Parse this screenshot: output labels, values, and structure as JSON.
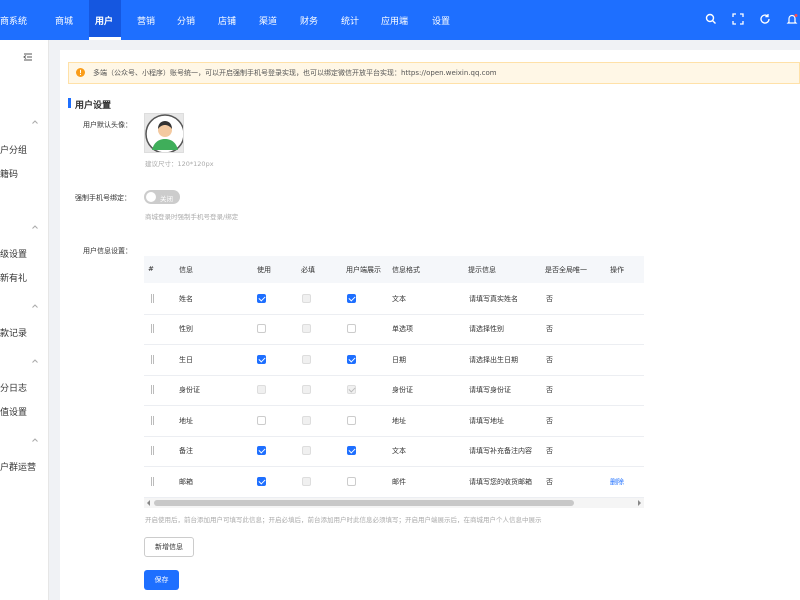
{
  "header": {
    "brand": "商系统",
    "nav": [
      "商城",
      "用户",
      "营销",
      "分销",
      "店铺",
      "渠道",
      "财务",
      "统计",
      "应用端",
      "设置"
    ],
    "active_index": 1
  },
  "sidebar": {
    "items": [
      "户分组",
      "籍码",
      "级设置",
      "新有礼",
      "款记录",
      "分日志",
      "值设置",
      "户群运营"
    ]
  },
  "notice": {
    "text": "多端（公众号、小程序）账号统一，可以开启强制手机号登录实现，也可以绑定微信开放平台实现：https://open.weixin.qq.com"
  },
  "section": {
    "title": "用户设置"
  },
  "form": {
    "avatar_label": "用户默认头像：",
    "avatar_hint": "建议尺寸：120*120px",
    "bind_phone_label": "强制手机号绑定：",
    "bind_phone_toggle": "关闭",
    "bind_phone_hint": "商城登录时强制手机号登录/绑定",
    "info_label": "用户信息设置：",
    "table_hint": "开启使用后，前台添加用户可填写此信息；开启必填后，前台添加用户时此信息必须填写；开启用户端展示后，在商城用户个人信息中展示",
    "add_button": "新增信息",
    "save_button": "保存"
  },
  "table": {
    "headers": [
      "#",
      "信息",
      "使用",
      "必填",
      "用户端展示",
      "信息格式",
      "提示信息",
      "是否全局唯一",
      "操作"
    ],
    "rows": [
      {
        "name": "姓名",
        "use": true,
        "required": false,
        "show": true,
        "format": "文本",
        "tip": "请填写真实姓名",
        "unique": "否",
        "action": "",
        "locked": false
      },
      {
        "name": "性别",
        "use": false,
        "required": false,
        "show": false,
        "format": "单选项",
        "tip": "请选择性别",
        "unique": "否",
        "action": "",
        "locked": false
      },
      {
        "name": "生日",
        "use": true,
        "required": false,
        "show": true,
        "format": "日期",
        "tip": "请选择出生日期",
        "unique": "否",
        "action": "",
        "locked": false
      },
      {
        "name": "身份证",
        "use": false,
        "required": false,
        "show": true,
        "format": "身份证",
        "tip": "请填写身份证",
        "unique": "否",
        "action": "",
        "locked": true
      },
      {
        "name": "地址",
        "use": false,
        "required": false,
        "show": false,
        "format": "地址",
        "tip": "请填写地址",
        "unique": "否",
        "action": "",
        "locked": false
      },
      {
        "name": "备注",
        "use": true,
        "required": false,
        "show": true,
        "format": "文本",
        "tip": "请填写补充备注内容",
        "unique": "否",
        "action": "",
        "locked": false
      },
      {
        "name": "邮箱",
        "use": true,
        "required": false,
        "show": false,
        "format": "邮件",
        "tip": "请填写您的收货邮箱",
        "unique": "否",
        "action": "删除",
        "locked": false
      }
    ]
  },
  "colors": {
    "primary": "#1e6fff",
    "notice_bg": "#fff7e6"
  }
}
